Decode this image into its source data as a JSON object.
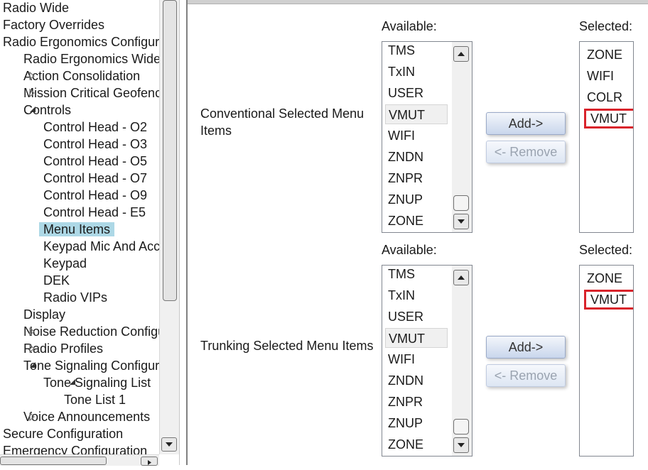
{
  "tree": {
    "items": [
      {
        "label": "Radio Wide",
        "expander": ""
      },
      {
        "label": "Factory Overrides",
        "expander": ""
      },
      {
        "label": "Radio Ergonomics Configura",
        "expander": ""
      },
      {
        "label": "Radio Ergonomics Wide",
        "expander": ""
      },
      {
        "label": "Action Consolidation",
        "expander": "collapsed"
      },
      {
        "label": "Mission Critical Geofenc",
        "expander": "collapsed"
      },
      {
        "label": "Controls",
        "expander": "expanded"
      },
      {
        "label": "Control Head - O2",
        "expander": ""
      },
      {
        "label": "Control Head - O3",
        "expander": ""
      },
      {
        "label": "Control Head - O5",
        "expander": ""
      },
      {
        "label": "Control Head - O7",
        "expander": ""
      },
      {
        "label": "Control Head - O9",
        "expander": ""
      },
      {
        "label": "Control Head - E5",
        "expander": ""
      },
      {
        "label": "Menu Items",
        "expander": "",
        "selected": true
      },
      {
        "label": "Keypad Mic And Acc",
        "expander": ""
      },
      {
        "label": "Keypad",
        "expander": ""
      },
      {
        "label": "DEK",
        "expander": ""
      },
      {
        "label": "Radio VIPs",
        "expander": ""
      },
      {
        "label": "Display",
        "expander": ""
      },
      {
        "label": "Noise Reduction Configu",
        "expander": "collapsed"
      },
      {
        "label": "Radio Profiles",
        "expander": "collapsed"
      },
      {
        "label": "Tone Signaling Configur",
        "expander": "expanded"
      },
      {
        "label": "Tone Signaling List",
        "expander": "expanded"
      },
      {
        "label": "Tone List 1",
        "expander": ""
      },
      {
        "label": "Voice Announcements",
        "expander": "collapsed"
      },
      {
        "label": "Secure Configuration",
        "expander": ""
      },
      {
        "label": "Emergency Configuration",
        "expander": ""
      }
    ]
  },
  "colors": {
    "selection_highlight": "#add8e6",
    "marker_red": "#d9232b",
    "button_blue": "#c9d6ec"
  },
  "sections": [
    {
      "title": "Conventional Selected Menu Items",
      "available_label": "Available:",
      "selected_label": "Selected:",
      "available": [
        "TMS",
        "TxIN",
        "USER",
        "VMUT",
        "WIFI",
        "ZNDN",
        "ZNPR",
        "ZNUP",
        "ZONE"
      ],
      "available_highlighted": "VMUT",
      "selected": [
        "ZONE",
        "WIFI",
        "COLR",
        "VMUT"
      ],
      "selected_marked": "VMUT",
      "add_label": "Add->",
      "remove_label": "<- Remove"
    },
    {
      "title": "Trunking Selected Menu Items",
      "available_label": "Available:",
      "selected_label": "Selected:",
      "available": [
        "TMS",
        "TxIN",
        "USER",
        "VMUT",
        "WIFI",
        "ZNDN",
        "ZNPR",
        "ZNUP",
        "ZONE"
      ],
      "available_highlighted": "VMUT",
      "selected": [
        "ZONE",
        "VMUT"
      ],
      "selected_marked": "VMUT",
      "add_label": "Add->",
      "remove_label": "<- Remove"
    }
  ]
}
